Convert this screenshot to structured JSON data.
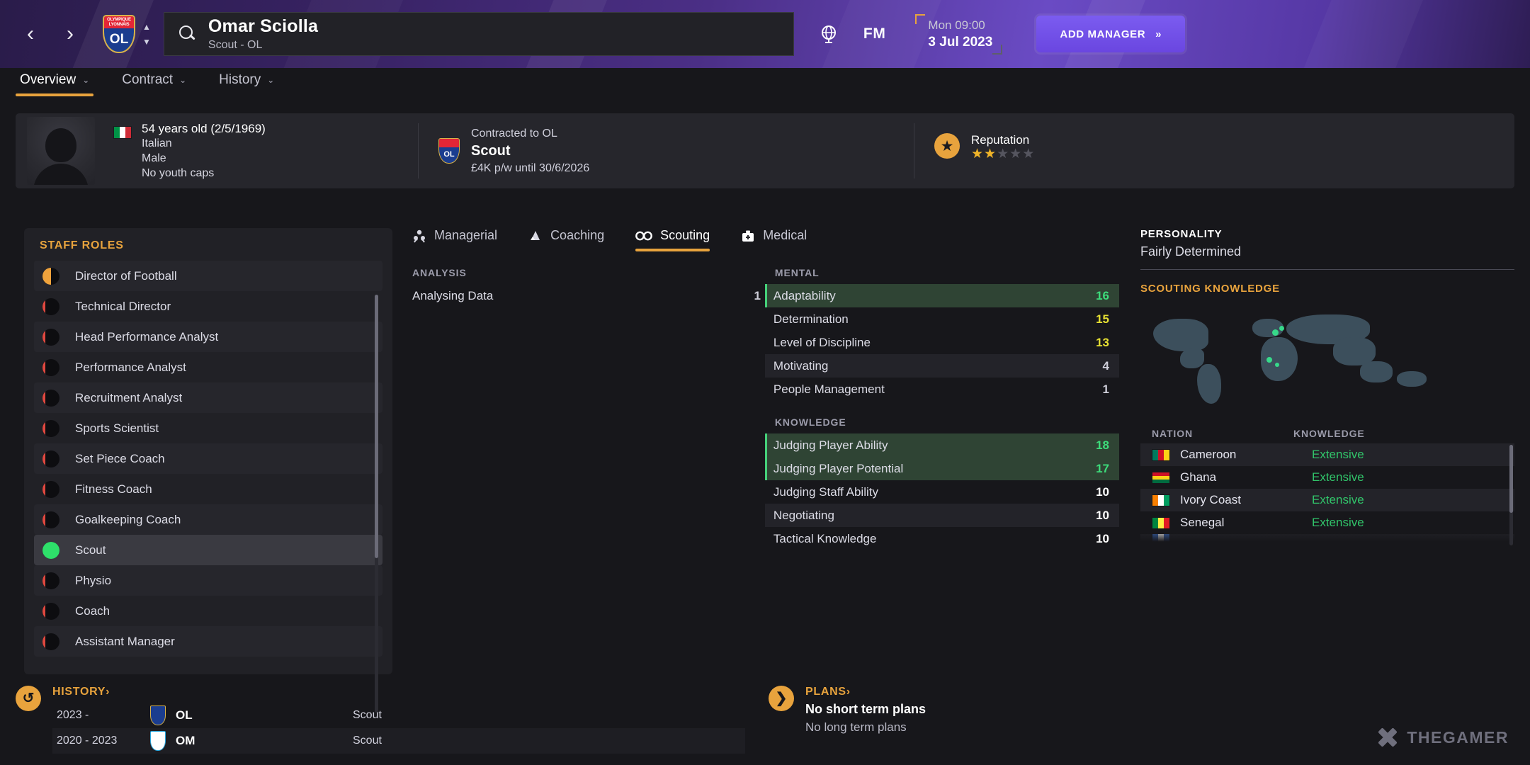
{
  "header": {
    "nav": {
      "back": "‹",
      "forward": "›"
    },
    "club_crest": {
      "top_line1": "OLYMPIQUE",
      "top_line2": "LYONNAIS",
      "abbr": "OL"
    },
    "search": {
      "name": "Omar Sciolla",
      "subtitle": "Scout - OL",
      "icon": "search-icon"
    },
    "globe_icon": "globe-icon",
    "fm_logo": "FM",
    "date": {
      "time": "Mon 09:00",
      "day": "3 Jul 2023"
    },
    "add_manager": {
      "label": "ADD MANAGER",
      "chevrons": "»"
    }
  },
  "subtabs": [
    {
      "label": "Overview",
      "active": true,
      "caret": "⌄"
    },
    {
      "label": "Contract",
      "active": false,
      "caret": "⌄"
    },
    {
      "label": "History",
      "active": false,
      "caret": "⌄"
    }
  ],
  "profile": {
    "personal": {
      "nationality_flag": "italy-flag",
      "age_line": "54 years old (2/5/1969)",
      "nationality": "Italian",
      "gender": "Male",
      "caps": "No youth caps"
    },
    "contract": {
      "club_label": "Contracted to OL",
      "role": "Scout",
      "terms": "£4K p/w until 30/6/2026",
      "crest_abbr": "OL"
    },
    "reputation": {
      "label": "Reputation",
      "stars_filled": 2,
      "stars_total": 5
    }
  },
  "sidebar": {
    "title": "STAFF ROLES",
    "items": [
      {
        "label": "Director of Football",
        "dot": "orange-half",
        "selected": false
      },
      {
        "label": "Technical Director",
        "dot": "red-sliver",
        "selected": false
      },
      {
        "label": "Head Performance Analyst",
        "dot": "red-sliver",
        "selected": false
      },
      {
        "label": "Performance Analyst",
        "dot": "red-sliver",
        "selected": false
      },
      {
        "label": "Recruitment Analyst",
        "dot": "red-sliver",
        "selected": false
      },
      {
        "label": "Sports Scientist",
        "dot": "red-sliver",
        "selected": false
      },
      {
        "label": "Set Piece Coach",
        "dot": "red-sliver",
        "selected": false
      },
      {
        "label": "Fitness Coach",
        "dot": "red-sliver",
        "selected": false
      },
      {
        "label": "Goalkeeping Coach",
        "dot": "red-sliver",
        "selected": false
      },
      {
        "label": "Scout",
        "dot": "green-full",
        "selected": true
      },
      {
        "label": "Physio",
        "dot": "red-sliver",
        "selected": false
      },
      {
        "label": "Coach",
        "dot": "red-sliver",
        "selected": false
      },
      {
        "label": "Assistant Manager",
        "dot": "red-sliver",
        "selected": false
      }
    ]
  },
  "attribute_tabs": [
    {
      "label": "Managerial",
      "icon": "managerial-icon",
      "active": false
    },
    {
      "label": "Coaching",
      "icon": "coaching-icon",
      "active": false
    },
    {
      "label": "Scouting",
      "icon": "binoculars-icon",
      "active": true
    },
    {
      "label": "Medical",
      "icon": "medical-bag-icon",
      "active": false
    }
  ],
  "attributes": {
    "analysis": {
      "title": "ANALYSIS",
      "rows": [
        {
          "name": "Analysing Data",
          "value": "1",
          "color": "grey",
          "highlight": false
        }
      ]
    },
    "mental": {
      "title": "MENTAL",
      "rows": [
        {
          "name": "Adaptability",
          "value": "16",
          "color": "green",
          "highlight": true
        },
        {
          "name": "Determination",
          "value": "15",
          "color": "yellow",
          "highlight": false
        },
        {
          "name": "Level of Discipline",
          "value": "13",
          "color": "yellow",
          "highlight": false
        },
        {
          "name": "Motivating",
          "value": "4",
          "color": "grey",
          "highlight": false
        },
        {
          "name": "People Management",
          "value": "1",
          "color": "grey",
          "highlight": false
        }
      ]
    },
    "knowledge": {
      "title": "KNOWLEDGE",
      "rows": [
        {
          "name": "Judging Player Ability",
          "value": "18",
          "color": "green",
          "highlight": true
        },
        {
          "name": "Judging Player Potential",
          "value": "17",
          "color": "green",
          "highlight": true
        },
        {
          "name": "Judging Staff Ability",
          "value": "10",
          "color": "white",
          "highlight": false
        },
        {
          "name": "Negotiating",
          "value": "10",
          "color": "white",
          "highlight": false
        },
        {
          "name": "Tactical Knowledge",
          "value": "10",
          "color": "white",
          "highlight": false
        }
      ]
    }
  },
  "right_panel": {
    "personality_title": "PERSONALITY",
    "personality_value": "Fairly Determined",
    "scouting_title": "SCOUTING KNOWLEDGE",
    "map_icon": "world-map",
    "nation_header": {
      "nation": "NATION",
      "knowledge": "KNOWLEDGE"
    },
    "nations": [
      {
        "name": "Cameroon",
        "knowledge": "Extensive",
        "flag": "cameroon-flag"
      },
      {
        "name": "Ghana",
        "knowledge": "Extensive",
        "flag": "ghana-flag"
      },
      {
        "name": "Ivory Coast",
        "knowledge": "Extensive",
        "flag": "ivory-coast-flag"
      },
      {
        "name": "Senegal",
        "knowledge": "Extensive",
        "flag": "senegal-flag"
      }
    ]
  },
  "history": {
    "title": "HISTORY",
    "chevron": "›",
    "icon": "history-icon",
    "rows": [
      {
        "years": "2023 -",
        "club": "OL",
        "role": "Scout"
      },
      {
        "years": "2020 - 2023",
        "club": "OM",
        "role": "Scout"
      }
    ]
  },
  "plans": {
    "title": "PLANS",
    "chevron": "›",
    "icon": "plans-icon",
    "short_term": "No short term plans",
    "long_term": "No long term plans"
  },
  "watermark": {
    "text": "THEGAMER",
    "icon": "thegamer-logo"
  }
}
